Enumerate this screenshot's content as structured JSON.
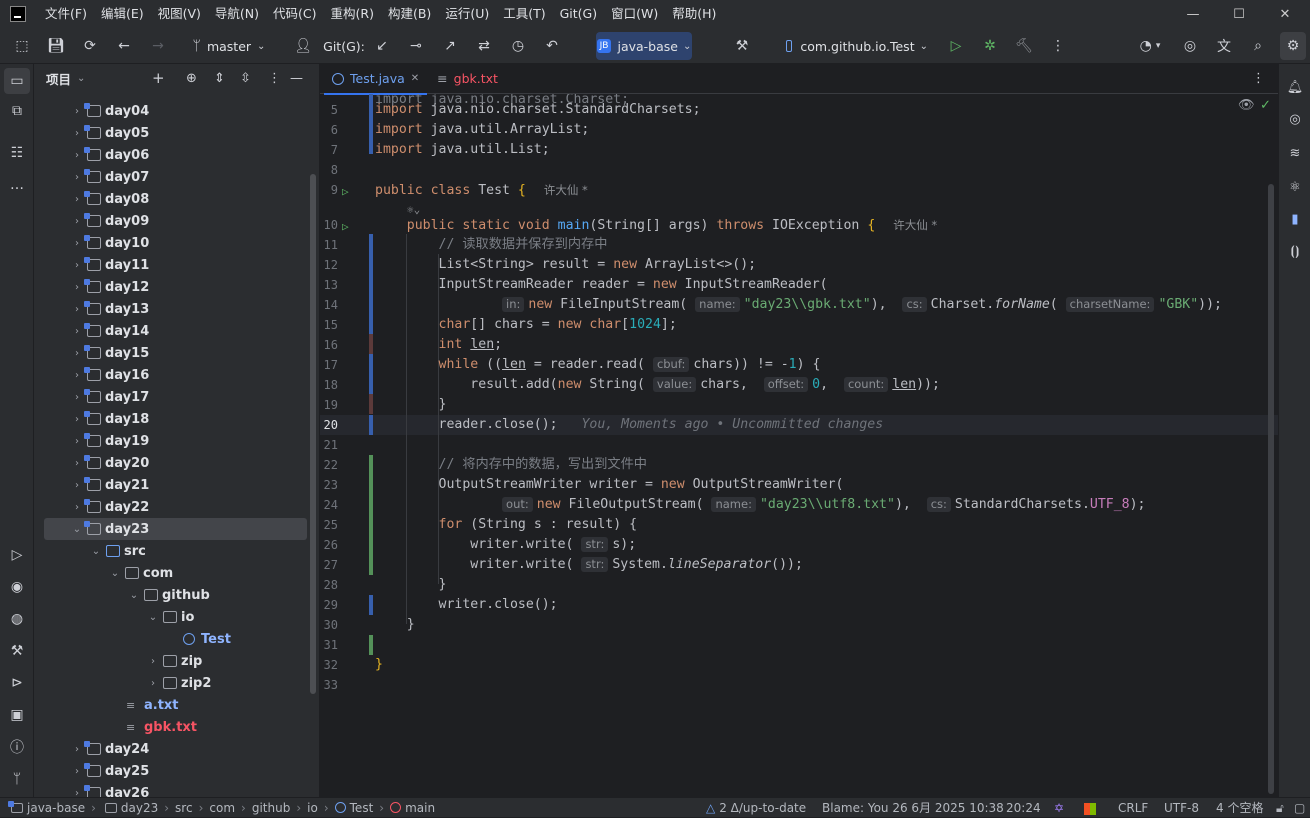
{
  "menu": [
    "文件(F)",
    "编辑(E)",
    "视图(V)",
    "导航(N)",
    "代码(C)",
    "重构(R)",
    "构建(B)",
    "运行(U)",
    "工具(T)",
    "Git(G)",
    "窗口(W)",
    "帮助(H)"
  ],
  "toolbar": {
    "branch": "master",
    "git_label": "Git(G):",
    "project_badge": "JB",
    "project_name": "java-base",
    "run_config": "com.github.io.Test"
  },
  "project_panel": {
    "title": "项目",
    "tree": [
      {
        "label": "day04",
        "type": "module",
        "indent": 0,
        "arrow": "›"
      },
      {
        "label": "day05",
        "type": "module",
        "indent": 0,
        "arrow": "›"
      },
      {
        "label": "day06",
        "type": "module",
        "indent": 0,
        "arrow": "›"
      },
      {
        "label": "day07",
        "type": "module",
        "indent": 0,
        "arrow": "›"
      },
      {
        "label": "day08",
        "type": "module",
        "indent": 0,
        "arrow": "›"
      },
      {
        "label": "day09",
        "type": "module",
        "indent": 0,
        "arrow": "›"
      },
      {
        "label": "day10",
        "type": "module",
        "indent": 0,
        "arrow": "›"
      },
      {
        "label": "day11",
        "type": "module",
        "indent": 0,
        "arrow": "›"
      },
      {
        "label": "day12",
        "type": "module",
        "indent": 0,
        "arrow": "›"
      },
      {
        "label": "day13",
        "type": "module",
        "indent": 0,
        "arrow": "›"
      },
      {
        "label": "day14",
        "type": "module",
        "indent": 0,
        "arrow": "›"
      },
      {
        "label": "day15",
        "type": "module",
        "indent": 0,
        "arrow": "›"
      },
      {
        "label": "day16",
        "type": "module",
        "indent": 0,
        "arrow": "›"
      },
      {
        "label": "day17",
        "type": "module",
        "indent": 0,
        "arrow": "›"
      },
      {
        "label": "day18",
        "type": "module",
        "indent": 0,
        "arrow": "›"
      },
      {
        "label": "day19",
        "type": "module",
        "indent": 0,
        "arrow": "›"
      },
      {
        "label": "day20",
        "type": "module",
        "indent": 0,
        "arrow": "›"
      },
      {
        "label": "day21",
        "type": "module",
        "indent": 0,
        "arrow": "›"
      },
      {
        "label": "day22",
        "type": "module",
        "indent": 0,
        "arrow": "›"
      },
      {
        "label": "day23",
        "type": "module",
        "indent": 0,
        "arrow": "⌄",
        "selected": true
      },
      {
        "label": "src",
        "type": "src",
        "indent": 1,
        "arrow": "⌄"
      },
      {
        "label": "com",
        "type": "pkg",
        "indent": 2,
        "arrow": "⌄"
      },
      {
        "label": "github",
        "type": "pkg",
        "indent": 3,
        "arrow": "⌄"
      },
      {
        "label": "io",
        "type": "pkg",
        "indent": 4,
        "arrow": "⌄"
      },
      {
        "label": "Test",
        "type": "class",
        "indent": 5,
        "arrow": ""
      },
      {
        "label": "zip",
        "type": "pkg",
        "indent": 4,
        "arrow": "›"
      },
      {
        "label": "zip2",
        "type": "pkg",
        "indent": 4,
        "arrow": "›"
      },
      {
        "label": "a.txt",
        "type": "file",
        "indent": 2,
        "arrow": ""
      },
      {
        "label": "gbk.txt",
        "type": "file-err",
        "indent": 2,
        "arrow": ""
      },
      {
        "label": "day24",
        "type": "module",
        "indent": 0,
        "arrow": "›"
      },
      {
        "label": "day25",
        "type": "module",
        "indent": 0,
        "arrow": "›"
      },
      {
        "label": "day26",
        "type": "module",
        "indent": 0,
        "arrow": "›"
      }
    ]
  },
  "tabs": [
    {
      "label": "Test.java",
      "active": true
    },
    {
      "label": "gbk.txt",
      "active": false
    }
  ],
  "code": {
    "author": "许大仙 *",
    "blame_inline": "You, Moments ago • Uncommitted changes",
    "current_line": "20"
  },
  "status": {
    "crumbs": [
      "java-base",
      "day23",
      "src",
      "com",
      "github",
      "io",
      "Test",
      "main"
    ],
    "vcs": "2 Δ/up-to-date",
    "blame": "Blame: You 26 6月 2025 10:38",
    "position": "20:24",
    "line_sep": "CRLF",
    "encoding": "UTF-8",
    "indent": "4 个空格"
  },
  "colors": {
    "accent": "#3574f0",
    "added": "#549159",
    "modified": "#375fad"
  }
}
